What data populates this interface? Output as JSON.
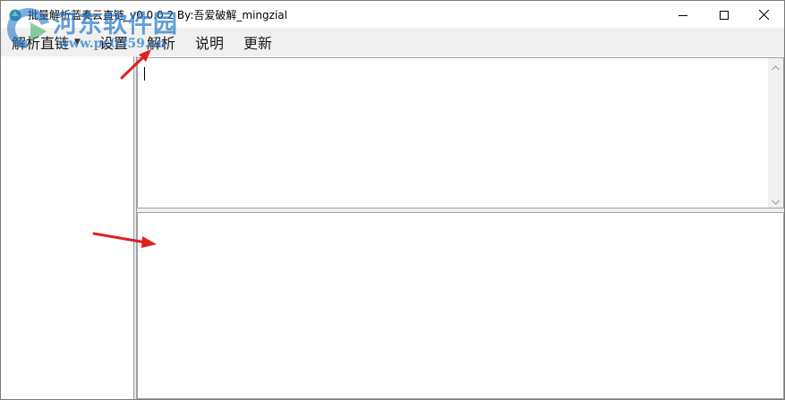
{
  "window": {
    "title": "批量解析蓝奏云直链_v0.0.0.2 By:吾爱破解_mingzial"
  },
  "title_buttons": {
    "minimize_icon": "minimize-icon",
    "maximize_icon": "maximize-icon",
    "close_icon": "close-icon"
  },
  "watermark": {
    "text": "河东软件园",
    "url": "www.pc0359.cn"
  },
  "menu": {
    "items": [
      {
        "label": "解析直链",
        "has_dropdown": true
      },
      {
        "label": "设置"
      },
      {
        "label": "解析"
      },
      {
        "label": "说明"
      },
      {
        "label": "更新"
      }
    ]
  },
  "colors": {
    "annotation_arrow": "#e02020",
    "menu_bg": "#f0f0f0",
    "border": "#a0a0a0",
    "watermark": "#2878c8"
  }
}
